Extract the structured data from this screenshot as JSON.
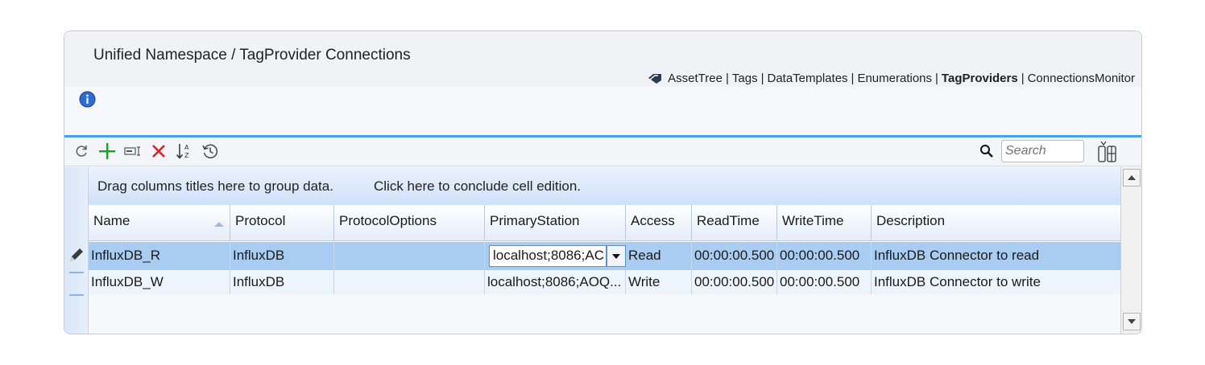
{
  "header": {
    "title": "Unified Namespace / TagProvider Connections",
    "breadcrumb": [
      {
        "label": "AssetTree",
        "active": false
      },
      {
        "label": "Tags",
        "active": false
      },
      {
        "label": "DataTemplates",
        "active": false
      },
      {
        "label": "Enumerations",
        "active": false
      },
      {
        "label": "TagProviders",
        "active": true
      },
      {
        "label": "ConnectionsMonitor",
        "active": false
      }
    ],
    "separator": "|"
  },
  "toolbar": {
    "buttons": [
      "refresh-icon",
      "add-icon",
      "rename-icon",
      "delete-icon",
      "sort-icon",
      "history-icon"
    ],
    "search_placeholder": "Search"
  },
  "grid": {
    "group_hint": "Drag columns titles here to group data.",
    "conclude_hint": "Click here to conclude cell edition.",
    "columns": [
      "Name",
      "Protocol",
      "ProtocolOptions",
      "PrimaryStation",
      "Access",
      "ReadTime",
      "WriteTime",
      "Description"
    ],
    "rows": [
      {
        "name": "InfluxDB_R",
        "protocol": "InfluxDB",
        "protocol_options": "",
        "primary_station": "localhost;8086;AC",
        "access": "Read",
        "read_time": "00:00:00.500",
        "write_time": "00:00:00.500",
        "description": "InfluxDB Connector to read"
      },
      {
        "name": "InfluxDB_W",
        "protocol": "InfluxDB",
        "protocol_options": "",
        "primary_station": "localhost;8086;AOQ...",
        "access": "Write",
        "read_time": "00:00:00.500",
        "write_time": "00:00:00.500",
        "description": "InfluxDB Connector to write"
      }
    ]
  },
  "colors": {
    "accent": "#4aa0e6",
    "selected_row": "#a9cdf2",
    "delete": "#e02020",
    "add": "#1f9e2c"
  }
}
